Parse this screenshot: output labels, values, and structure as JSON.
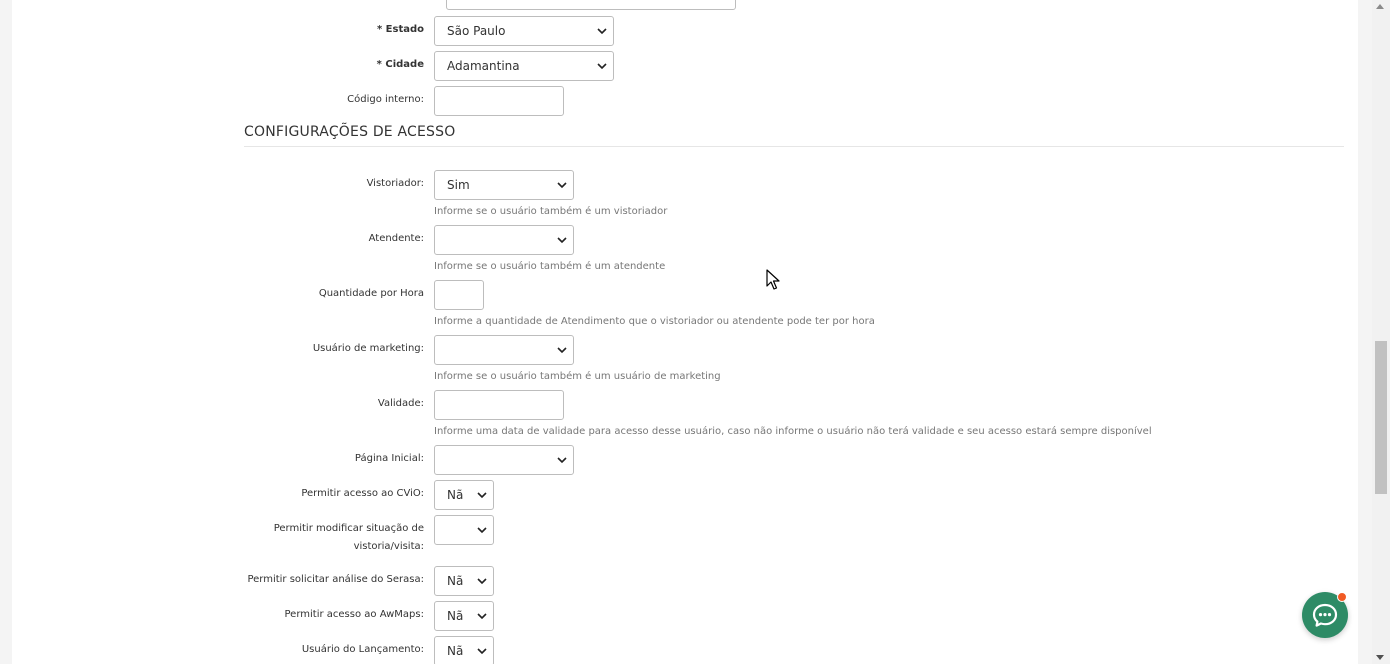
{
  "address_section": {
    "estado": {
      "required_mark": "* ",
      "label": "Estado",
      "value": "São Paulo"
    },
    "cidade": {
      "required_mark": "* ",
      "label": "Cidade",
      "value": "Adamantina"
    },
    "codigo_interno": {
      "label": "Código interno:",
      "value": ""
    }
  },
  "access_section": {
    "title": "CONFIGURAÇÕES DE ACESSO",
    "vistoriador": {
      "label": "Vistoriador:",
      "value": "Sim",
      "help": "Informe se o usuário também é um vistoriador"
    },
    "atendente": {
      "label": "Atendente:",
      "value": "",
      "help": "Informe se o usuário também é um atendente"
    },
    "quantidade_hora": {
      "label": "Quantidade por Hora",
      "value": "",
      "help": "Informe a quantidade de Atendimento que o vistoriador ou atendente pode ter por hora"
    },
    "usuario_marketing": {
      "label": "Usuário de marketing:",
      "value": "",
      "help": "Informe se o usuário também é um usuário de marketing"
    },
    "validade": {
      "label": "Validade:",
      "value": "",
      "help": "Informe uma data de validade para acesso desse usuário, caso não informe o usuário não terá validade e seu acesso estará sempre disponível"
    },
    "pagina_inicial": {
      "label": "Página Inicial:",
      "value": ""
    },
    "acesso_cvio": {
      "label": "Permitir acesso ao CViO:",
      "value": "Nã"
    },
    "modificar_situacao": {
      "label_line1": "Permitir modificar situação de",
      "label_line2": "vistoria/visita:",
      "value": ""
    },
    "analise_serasa": {
      "label": "Permitir solicitar análise do Serasa:",
      "value": "Nã"
    },
    "acesso_awmaps": {
      "label": "Permitir acesso ao AwMaps:",
      "value": "Nã"
    },
    "usuario_lancamento": {
      "label": "Usuário do Lançamento:",
      "value": "Nã"
    }
  },
  "icons": {
    "dropdown": "chevron-down-icon",
    "chat": "chat-bubble-icon",
    "cursor": "mouse-pointer-icon"
  },
  "colors": {
    "chat_button": "#2e8b66",
    "notification_dot": "#f15a24",
    "help_text": "#777777"
  }
}
